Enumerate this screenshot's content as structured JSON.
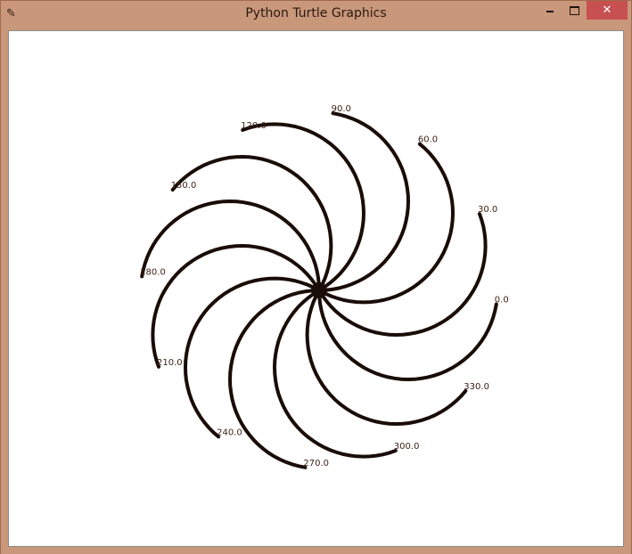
{
  "window": {
    "title": "Python Turtle Graphics",
    "app_icon": "feather-icon",
    "close_glyph": "✕"
  },
  "colors": {
    "frame": "#c9977a",
    "canvas": "#ffffff",
    "stroke": "#1a0c06",
    "label": "#3b1f12",
    "close": "#c75050"
  },
  "drawing": {
    "labels": [
      "0.0",
      "30.0",
      "60.0",
      "90.0",
      "120.0",
      "150.0",
      "180.0",
      "210.0",
      "240.0",
      "270.0",
      "300.0",
      "330.0"
    ]
  }
}
